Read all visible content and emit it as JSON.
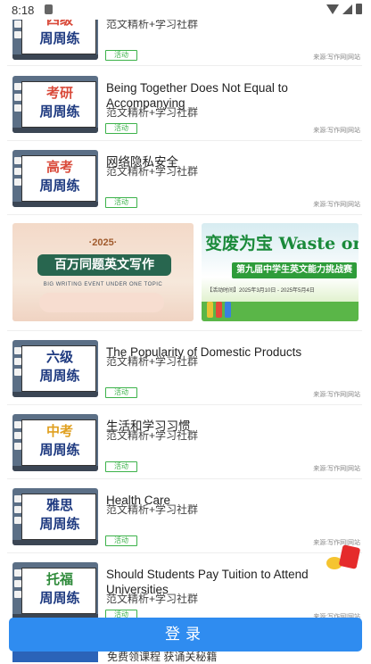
{
  "status_bar": {
    "time": "8:18"
  },
  "articles": [
    {
      "thumb_line1": "四级",
      "thumb_line2": "周周练",
      "line1_color": "#d94a3a",
      "title": "",
      "subtitle": "范文精析+学习社群",
      "tag": "活动",
      "source": "来源:写作网|网站"
    },
    {
      "thumb_line1": "考研",
      "thumb_line2": "周周练",
      "line1_color": "#d94a3a",
      "title": "Being Together Does Not Equal to Accompanying",
      "subtitle": "范文精析+学习社群",
      "tag": "活动",
      "source": "来源:写作网|网站"
    },
    {
      "thumb_line1": "高考",
      "thumb_line2": "周周练",
      "line1_color": "#d94a3a",
      "title": "网络隐私安全",
      "subtitle": "范文精析+学习社群",
      "tag": "活动",
      "source": "来源:写作网|网站"
    },
    {
      "thumb_line1": "六级",
      "thumb_line2": "周周练",
      "line1_color": "#1e3a80",
      "title": "The Popularity of Domestic Products",
      "subtitle": "范文精析+学习社群",
      "tag": "活动",
      "source": "来源:写作网|网站"
    },
    {
      "thumb_line1": "中考",
      "thumb_line2": "周周练",
      "line1_color": "#e0a020",
      "title": "生活和学习习惯",
      "subtitle": "范文精析+学习社群",
      "tag": "活动",
      "source": "来源:写作网|网站"
    },
    {
      "thumb_line1": "雅思",
      "thumb_line2": "周周练",
      "line1_color": "#1e3a80",
      "title": "Health Care",
      "subtitle": "范文精析+学习社群",
      "tag": "活动",
      "source": "来源:写作网|网站"
    },
    {
      "thumb_line1": "托福",
      "thumb_line2": "周周练",
      "line1_color": "#2e8a3a",
      "title": "Should Students Pay Tuition to Attend Universities",
      "subtitle": "范文精析+学习社群",
      "tag": "活动",
      "source": "来源:写作网|网站"
    }
  ],
  "banners": {
    "left": {
      "year": "·2025·",
      "title": "百万同题英文写作",
      "english": "BIG WRITING EVENT UNDER ONE TOPIC"
    },
    "right": {
      "title": "变废为宝 Waste or Treas",
      "ribbon": "第九届中学生英文能力挑战赛",
      "date": "【活动时间】2025年3月10日 - 2025年5月4日"
    }
  },
  "login_button": "登录",
  "peek_text": "免费领课程 获诵关秘籍"
}
